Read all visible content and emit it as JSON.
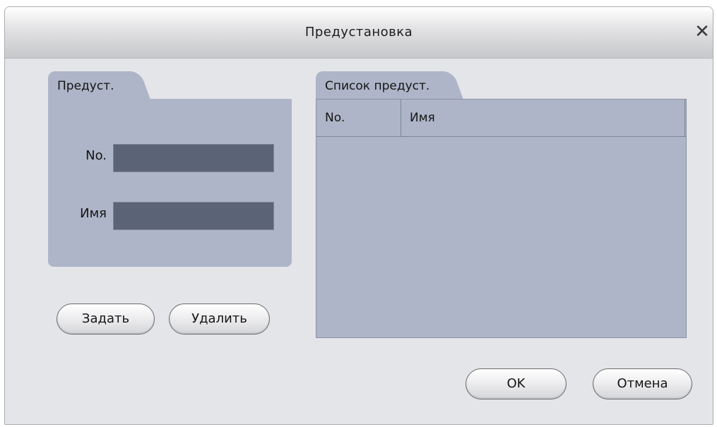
{
  "dialog": {
    "title": "Предустановка",
    "close_glyph": "✕"
  },
  "preset_panel": {
    "tab_label": "Предуст.",
    "no_label": "No.",
    "no_value": "",
    "name_label": "Имя",
    "name_value": ""
  },
  "preset_list": {
    "tab_label": "Список предуст.",
    "columns": [
      "No.",
      "Имя"
    ],
    "rows": []
  },
  "buttons": {
    "set": "Задать",
    "delete": "Удалить",
    "ok": "OK",
    "cancel": "Отмена"
  },
  "icons": {
    "close": "close-icon"
  }
}
